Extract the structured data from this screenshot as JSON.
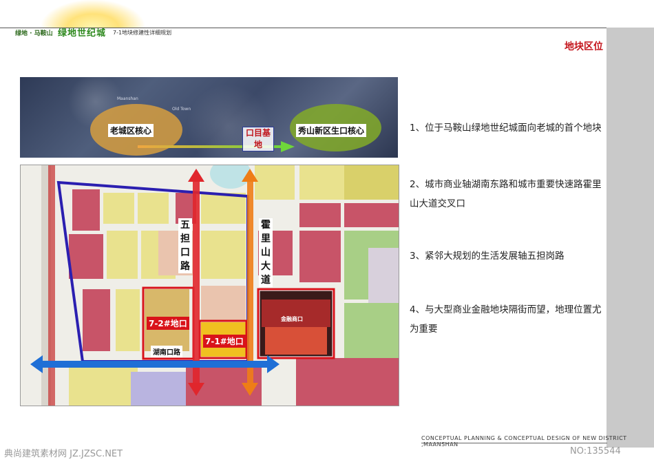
{
  "header": {
    "brand_prefix": "绿地 · 马鞍山",
    "brand_name": "绿地世纪城",
    "doc_title": "7-1地块修建性详细规划"
  },
  "section_title": "地块区位",
  "satellite": {
    "old_core": "老城区核心",
    "new_core": "秀山新区生口核心",
    "site_line1": "口目基",
    "site_line2": "地",
    "caption_1": "Maanshan",
    "caption_2": "Old Town"
  },
  "map": {
    "road_wudan": "五担口路",
    "road_huoli": "霍里山大道",
    "road_hunan": "湖南口路",
    "plot_72": "7-2#地口",
    "plot_71": "7-1#地口",
    "finance": "金融商口"
  },
  "points": [
    "1、位于马鞍山绿地世纪城面向老城的首个地块",
    "2、城市商业轴湖南东路和城市重要快速路霍里山大道交叉口",
    "3、紧邻大规划的生活发展轴五担岗路",
    "4、与大型商业金融地块隔街而望，地理位置尤为重要"
  ],
  "footer": {
    "english": "CONCEPTUAL PLANNING & CONCEPTUAL DESIGN OF NEW DISTRICT ,MAANSHAN",
    "watermark": "典尚建筑素材网 JZ.JZSC.NET",
    "number": "NO:135544"
  },
  "colors": {
    "accent_red": "#c4151c",
    "brand_green": "#2f8a1f",
    "arrow_red": "#e0262c",
    "arrow_orange": "#ee7d17",
    "arrow_blue": "#1f6fd6",
    "boundary_blue": "#2b1fb0"
  }
}
